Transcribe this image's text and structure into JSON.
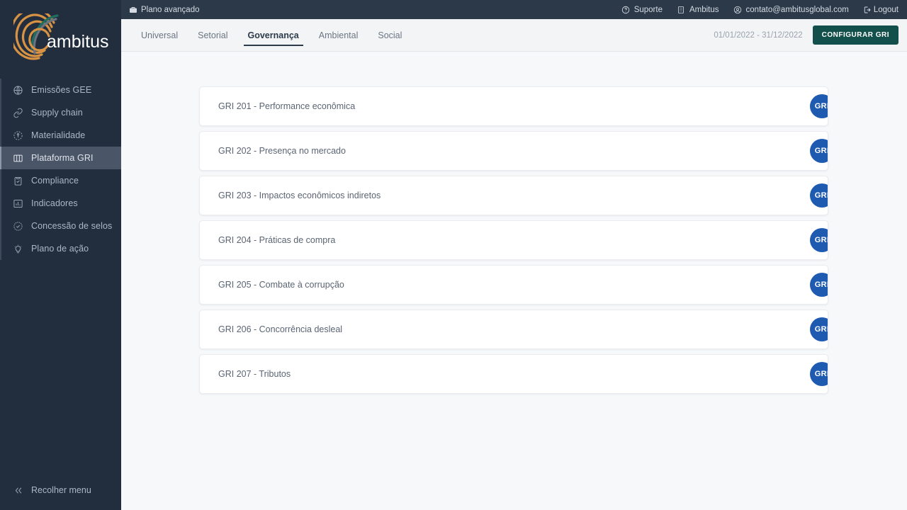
{
  "sidebar": {
    "logo_text": "ambitus",
    "items": [
      {
        "label": "Emissões GEE",
        "icon": "globe-icon",
        "active": false
      },
      {
        "label": "Supply chain",
        "icon": "link-icon",
        "active": false
      },
      {
        "label": "Materialidade",
        "icon": "materiality-icon",
        "active": false
      },
      {
        "label": "Plataforma GRI",
        "icon": "columns-icon",
        "active": true
      },
      {
        "label": "Compliance",
        "icon": "clipboard-check-icon",
        "active": false
      },
      {
        "label": "Indicadores",
        "icon": "bar-chart-icon",
        "active": false
      },
      {
        "label": "Concessão de selos",
        "icon": "seal-check-icon",
        "active": false
      },
      {
        "label": "Plano de ação",
        "icon": "lightbulb-icon",
        "active": false
      }
    ],
    "collapse_label": "Recolher menu",
    "collapse_icon": "chevrons-left-icon"
  },
  "topbar": {
    "plan_label": "Plano avançado",
    "plan_icon": "briefcase-icon",
    "right_items": [
      {
        "label": "Suporte",
        "icon": "help-circle-icon"
      },
      {
        "label": "Ambitus",
        "icon": "building-icon"
      },
      {
        "label": "contato@ambitusglobal.com",
        "icon": "account-circle-icon"
      },
      {
        "label": "Logout",
        "icon": "logout-icon"
      }
    ]
  },
  "tabbar": {
    "tabs": [
      {
        "label": "Universal",
        "active": false
      },
      {
        "label": "Setorial",
        "active": false
      },
      {
        "label": "Governança",
        "active": true
      },
      {
        "label": "Ambiental",
        "active": false
      },
      {
        "label": "Social",
        "active": false
      }
    ],
    "date_range": "01/01/2022 - 31/12/2022",
    "config_button": "CONFIGURAR GRI"
  },
  "main": {
    "cards": [
      {
        "title": "GRI 201 - Performance econômica",
        "badge": "GRI"
      },
      {
        "title": "GRI 202 - Presença no mercado",
        "badge": "GRI"
      },
      {
        "title": "GRI 203 - Impactos econômicos indiretos",
        "badge": "GRI"
      },
      {
        "title": "GRI 204 - Práticas de compra",
        "badge": "GRI"
      },
      {
        "title": "GRI 205 - Combate à corrupção",
        "badge": "GRI"
      },
      {
        "title": "GRI 206 - Concorrência desleal",
        "badge": "GRI"
      },
      {
        "title": "GRI 207 - Tributos",
        "badge": "GRI"
      }
    ]
  },
  "colors": {
    "sidebar_bg": "#222e3e",
    "topbar_bg": "#2b3949",
    "tabbar_bg": "#f2f4f6",
    "content_bg": "#f7f8fa",
    "accent_button": "#13504b",
    "badge_blue": "#1e5bb0",
    "active_nav_bg": "#4a5667"
  }
}
